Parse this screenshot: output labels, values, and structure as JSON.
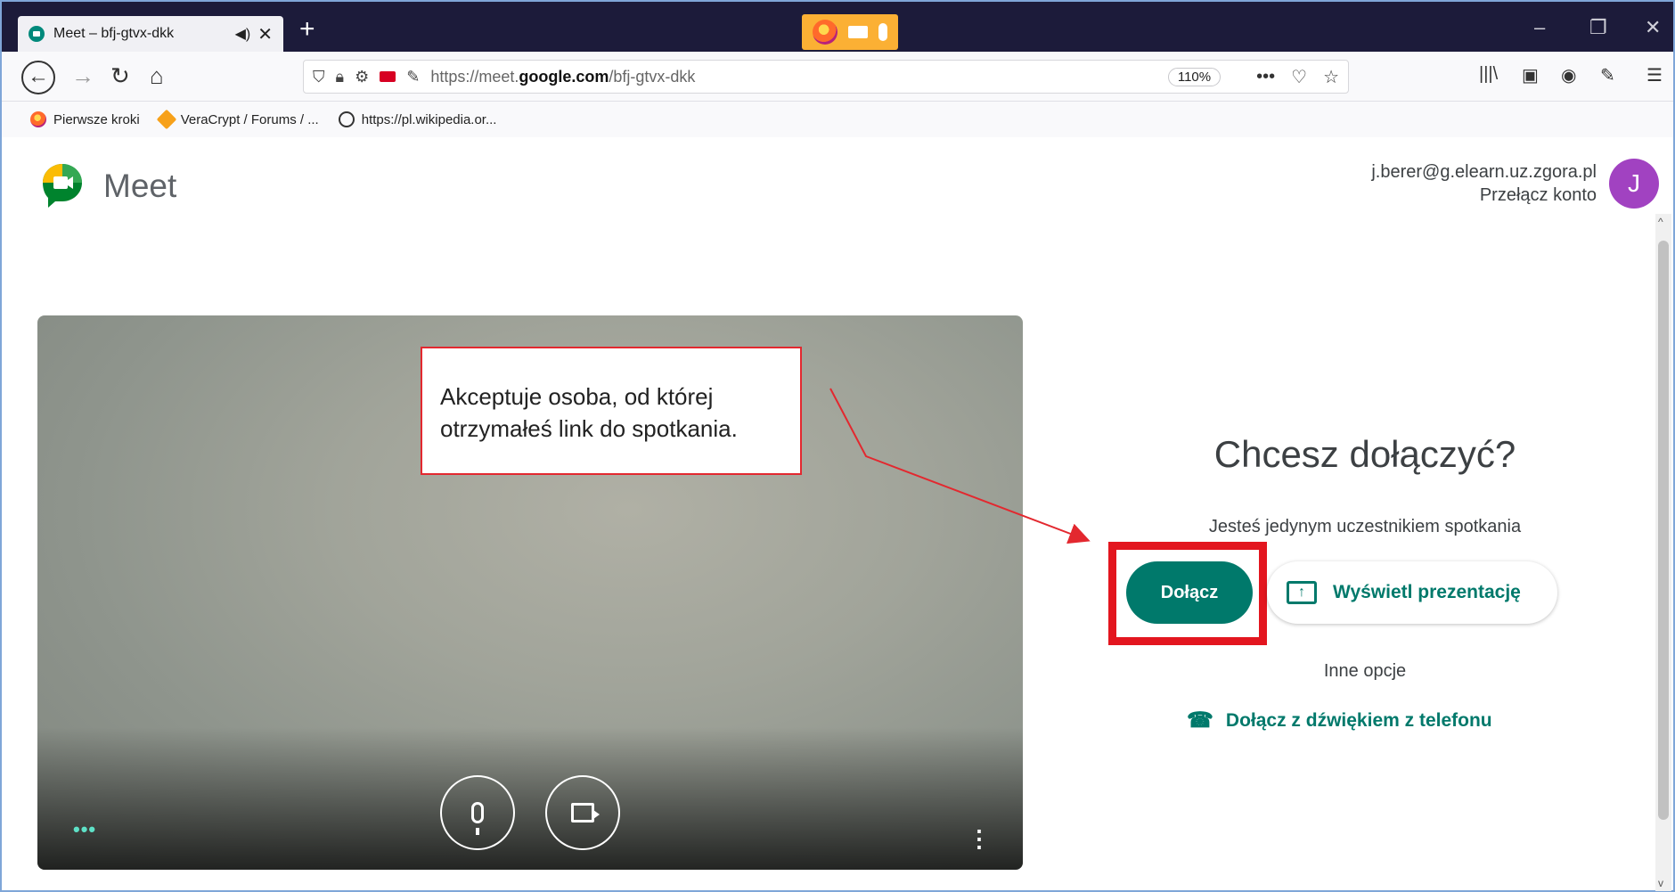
{
  "browser": {
    "tab": {
      "title": "Meet – bfj-gtvx-dkk",
      "audio_glyph": "◀)",
      "close_glyph": "✕"
    },
    "new_tab_glyph": "+",
    "window_controls": {
      "minimize": "–",
      "restore": "❐",
      "close": "✕"
    },
    "nav": {
      "back": "←",
      "forward": "→",
      "reload": "↻",
      "home": "⌂"
    },
    "url": {
      "prefix": "https://meet.",
      "domain": "google.com",
      "path": "/bfj-gtvx-dkk"
    },
    "zoom": "110%",
    "url_actions": {
      "more": "•••",
      "pocket": "♡",
      "bookmark": "☆"
    },
    "toolbar": {
      "library": "|||\\",
      "sidebar": "▣",
      "account": "◉",
      "extension": "✎",
      "menu": "☰"
    },
    "bookmarks": [
      {
        "label": "Pierwsze kroki",
        "icon": "firefox-icon"
      },
      {
        "label": "VeraCrypt / Forums / ...",
        "icon": "veracrypt-icon"
      },
      {
        "label": "https://pl.wikipedia.or...",
        "icon": "globe-icon"
      }
    ]
  },
  "meet": {
    "brand": "Meet",
    "account_email": "j.berer@g.elearn.uz.zgora.pl",
    "switch_account": "Przełącz konto",
    "avatar_letter": "J",
    "join_title": "Chcesz dołączyć?",
    "join_subtitle": "Jesteś jedynym uczestnikiem spotkania",
    "join_button": "Dołącz",
    "present_button": "Wyświetl prezentację",
    "other_options": "Inne opcje",
    "phone_join": "Dołącz z dźwiękiem z telefonu",
    "video_more_dots": "•••",
    "video_kebab": "⋮"
  },
  "annotation": {
    "text": "Akceptuje osoba, od której otrzymałeś link do spotkania.",
    "color": "#e3282f"
  },
  "colors": {
    "accent": "#00796b",
    "avatar": "#a142c1",
    "highlight": "#e3161f"
  }
}
